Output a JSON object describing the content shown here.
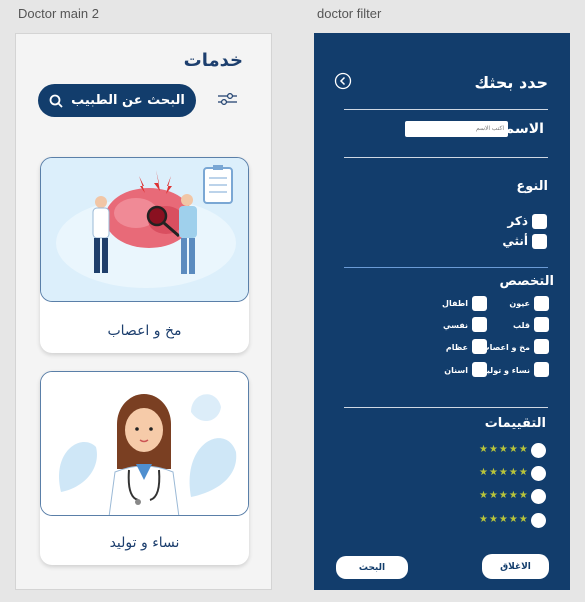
{
  "frames": {
    "left_label": "Doctor main 2",
    "right_label": "doctor filter"
  },
  "main": {
    "title": "خدمات",
    "search_button": "البحث عن الطبيب",
    "cards": [
      {
        "caption": "مخ  و اعصاب"
      },
      {
        "caption": "نساء و توليد"
      }
    ]
  },
  "filter": {
    "title": "حدد بحثك",
    "name_label": "الاسم",
    "name_placeholder": "اكتب الاسم",
    "gender_heading": "النوع",
    "gender_options": [
      "ذكر",
      "أنثي"
    ],
    "specialty_heading": "التخصص",
    "specialties": [
      "عيون",
      "اطفال",
      "قلب",
      "نفسي",
      "مخ و اعصاب",
      "عظام",
      "نساء و توليد",
      "اسنان"
    ],
    "ratings_heading": "التقييمات",
    "ratings": [
      "★★★★★",
      "★★★★★",
      "★★★★★",
      "★★★★★"
    ],
    "close_button": "الاغلاق",
    "search_button": "البحث"
  },
  "colors": {
    "navy": "#123d6c",
    "star": "#b7c33a"
  }
}
